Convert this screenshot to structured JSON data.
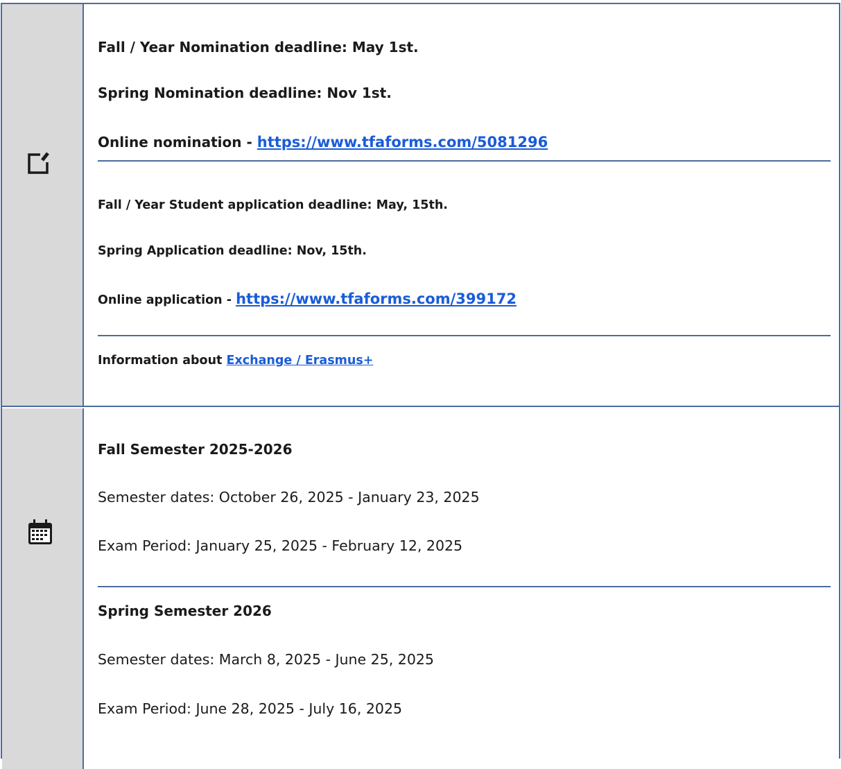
{
  "nomination": {
    "icon": "edit-icon",
    "fall_deadline": "Fall / Year Nomination deadline: May 1st.",
    "spring_deadline": "Spring Nomination deadline: Nov 1st.",
    "online_label": "Online nomination - ",
    "online_link": "https://www.tfaforms.com/5081296"
  },
  "application": {
    "fall_deadline": "Fall / Year Student application deadline: May, 15th.",
    "spring_deadline": "Spring Application deadline: Nov, 15th.",
    "online_label": "Online application - ",
    "online_link": "https://www.tfaforms.com/399172"
  },
  "info": {
    "label": "Information about ",
    "link": "Exchange / Erasmus+"
  },
  "calendar": {
    "icon": "calendar-icon",
    "fall": {
      "title": "Fall Semester 2025-2026",
      "semester_dates": "Semester dates: October 26, 2025 - January 23, 2025",
      "exam_period": "Exam Period: January 25, 2025 - February 12, 2025"
    },
    "spring": {
      "title": "Spring Semester 2026",
      "semester_dates": "Semester dates: March 8, 2025 - June 25, 2025",
      "exam_period": "Exam Period: June 28, 2025 - July 16, 2025"
    }
  },
  "colors": {
    "border": "#4b6c9e",
    "icon_cell_bg": "#d9d9d9",
    "link": "#1a5cd8"
  }
}
